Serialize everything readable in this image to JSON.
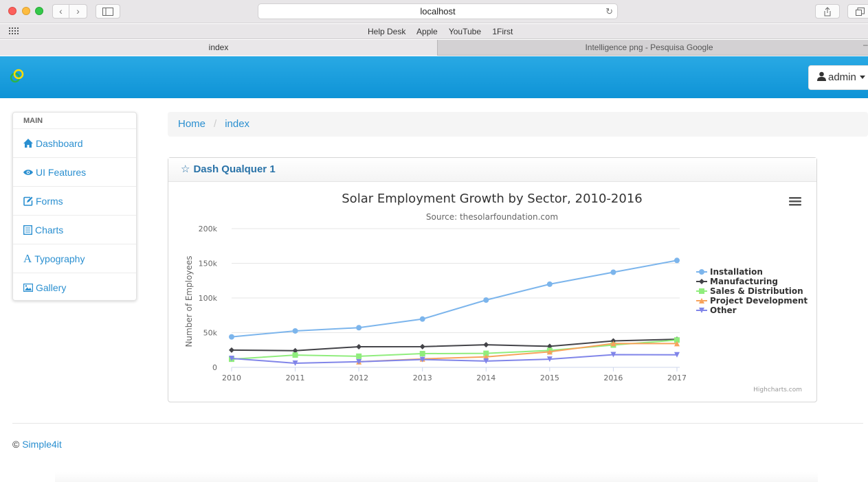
{
  "browser": {
    "url": "localhost",
    "favorites": [
      "Help Desk",
      "Apple",
      "YouTube",
      "1First"
    ],
    "tabs": [
      "index",
      "Intelligence png - Pesquisa Google"
    ]
  },
  "header": {
    "user_label": "admin"
  },
  "sidebar": {
    "section_label": "MAIN",
    "items": [
      {
        "label": "Dashboard",
        "icon": "home-icon"
      },
      {
        "label": "UI Features",
        "icon": "eye-icon"
      },
      {
        "label": "Forms",
        "icon": "edit-icon"
      },
      {
        "label": "Charts",
        "icon": "list-icon"
      },
      {
        "label": "Typography",
        "icon": "font-icon"
      },
      {
        "label": "Gallery",
        "icon": "picture-icon"
      }
    ]
  },
  "breadcrumb": {
    "home": "Home",
    "current": "index"
  },
  "panel": {
    "title": "Dash Qualquer 1"
  },
  "colors": {
    "accent": "#2a8fd0",
    "header": "#1a9ddf"
  },
  "chart_data": {
    "type": "line",
    "title": "Solar Employment Growth by Sector, 2010-2016",
    "subtitle": "Source: thesolarfoundation.com",
    "ylabel": "Number of Employees",
    "xlabel": "",
    "x": [
      "2010",
      "2011",
      "2012",
      "2013",
      "2014",
      "2015",
      "2016",
      "2017"
    ],
    "ylim": [
      0,
      200000
    ],
    "yticks": [
      "0",
      "50k",
      "100k",
      "150k",
      "200k"
    ],
    "grid": true,
    "legend_position": "right",
    "credits": "Highcharts.com",
    "series": [
      {
        "name": "Installation",
        "color": "#7cb5ec",
        "marker": "circle",
        "values": [
          43934,
          52503,
          57177,
          69658,
          97031,
          119931,
          137133,
          154175
        ]
      },
      {
        "name": "Manufacturing",
        "color": "#434348",
        "marker": "diamond",
        "values": [
          24916,
          24064,
          29742,
          29851,
          32490,
          30282,
          38121,
          40434
        ]
      },
      {
        "name": "Sales & Distribution",
        "color": "#90ed7d",
        "marker": "square",
        "values": [
          11744,
          17722,
          16005,
          19771,
          20185,
          24377,
          32147,
          39387
        ]
      },
      {
        "name": "Project Development",
        "color": "#f7a35c",
        "marker": "triangle",
        "values": [
          null,
          null,
          7988,
          12169,
          15112,
          22452,
          34400,
          34227
        ]
      },
      {
        "name": "Other",
        "color": "#8085e9",
        "marker": "triangle-down",
        "values": [
          12908,
          5948,
          8105,
          11248,
          8989,
          11816,
          18274,
          18111
        ]
      }
    ]
  }
}
